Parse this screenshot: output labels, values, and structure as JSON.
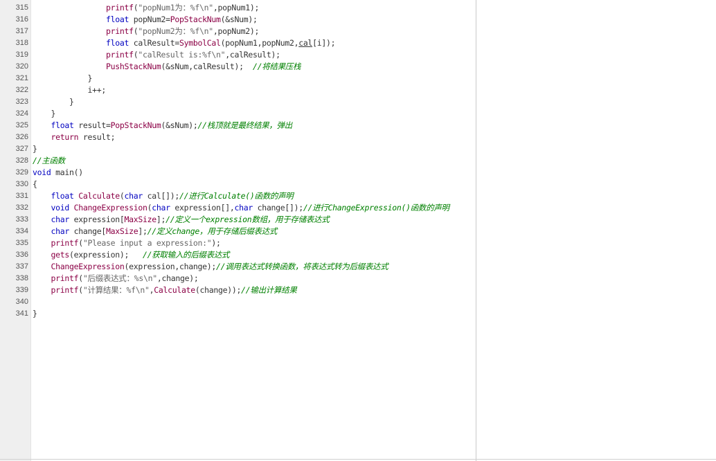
{
  "editor": {
    "lines": [
      {
        "n": "315",
        "segs": [
          {
            "t": "                printf(",
            "c": "fn0"
          },
          {
            "t": "\"popNum1为：%f\\n\"",
            "c": "str"
          },
          {
            "t": ",popNum1);",
            "c": "pl"
          }
        ]
      },
      {
        "n": "316",
        "segs": [
          {
            "t": "                ",
            "c": "pl"
          },
          {
            "t": "float",
            "c": "kw"
          },
          {
            "t": " popNum2=",
            "c": "pl"
          },
          {
            "t": "PopStackNum",
            "c": "fn"
          },
          {
            "t": "(&sNum);",
            "c": "pl"
          }
        ]
      },
      {
        "n": "317",
        "segs": [
          {
            "t": "                ",
            "c": "pl"
          },
          {
            "t": "printf",
            "c": "fn"
          },
          {
            "t": "(",
            "c": "pl"
          },
          {
            "t": "\"popNum2为：%f\\n\"",
            "c": "str"
          },
          {
            "t": ",popNum2);",
            "c": "pl"
          }
        ]
      },
      {
        "n": "318",
        "segs": [
          {
            "t": "                ",
            "c": "pl"
          },
          {
            "t": "float",
            "c": "kw"
          },
          {
            "t": " calResult=",
            "c": "pl"
          },
          {
            "t": "SymbolCal",
            "c": "fn"
          },
          {
            "t": "(popNum1,popNum2,",
            "c": "pl"
          },
          {
            "t": "cal",
            "c": "u"
          },
          {
            "t": "[i]);",
            "c": "pl"
          }
        ]
      },
      {
        "n": "319",
        "segs": [
          {
            "t": "                ",
            "c": "pl"
          },
          {
            "t": "printf",
            "c": "fn"
          },
          {
            "t": "(",
            "c": "pl"
          },
          {
            "t": "\"calResult is:%f\\n\"",
            "c": "str"
          },
          {
            "t": ",calResult);",
            "c": "pl"
          }
        ]
      },
      {
        "n": "320",
        "segs": [
          {
            "t": "                ",
            "c": "pl"
          },
          {
            "t": "PushStackNum",
            "c": "fn"
          },
          {
            "t": "(&sNum,calResult);  ",
            "c": "pl"
          },
          {
            "t": "//将结果压栈",
            "c": "cmt"
          }
        ]
      },
      {
        "n": "321",
        "segs": [
          {
            "t": "            }",
            "c": "pl"
          }
        ]
      },
      {
        "n": "322",
        "segs": [
          {
            "t": "            i++;",
            "c": "pl"
          }
        ]
      },
      {
        "n": "323",
        "segs": [
          {
            "t": "        }",
            "c": "pl"
          }
        ]
      },
      {
        "n": "324",
        "segs": [
          {
            "t": "    }",
            "c": "pl"
          }
        ]
      },
      {
        "n": "325",
        "segs": [
          {
            "t": "    ",
            "c": "pl"
          },
          {
            "t": "float",
            "c": "kw"
          },
          {
            "t": " result=",
            "c": "pl"
          },
          {
            "t": "PopStackNum",
            "c": "fn"
          },
          {
            "t": "(&sNum);",
            "c": "pl"
          },
          {
            "t": "//栈顶就是最终结果，弹出",
            "c": "cmt"
          }
        ]
      },
      {
        "n": "326",
        "segs": [
          {
            "t": "    ",
            "c": "pl"
          },
          {
            "t": "return",
            "c": "fn"
          },
          {
            "t": " result;",
            "c": "pl"
          }
        ]
      },
      {
        "n": "327",
        "segs": [
          {
            "t": "}",
            "c": "pl"
          }
        ]
      },
      {
        "n": "328",
        "segs": [
          {
            "t": "//主函数",
            "c": "cmt"
          }
        ]
      },
      {
        "n": "329",
        "segs": [
          {
            "t": "void",
            "c": "kw"
          },
          {
            "t": " main()",
            "c": "pl"
          }
        ]
      },
      {
        "n": "330",
        "segs": [
          {
            "t": "{",
            "c": "pl"
          }
        ]
      },
      {
        "n": "331",
        "segs": [
          {
            "t": "    ",
            "c": "pl"
          },
          {
            "t": "float",
            "c": "kw"
          },
          {
            "t": " ",
            "c": "pl"
          },
          {
            "t": "Calculate",
            "c": "fn"
          },
          {
            "t": "(",
            "c": "pl"
          },
          {
            "t": "char",
            "c": "kw"
          },
          {
            "t": " cal[]);",
            "c": "pl"
          },
          {
            "t": "//进行Calculate()函数的声明",
            "c": "cmt"
          }
        ]
      },
      {
        "n": "332",
        "segs": [
          {
            "t": "    ",
            "c": "pl"
          },
          {
            "t": "void",
            "c": "kw"
          },
          {
            "t": " ",
            "c": "pl"
          },
          {
            "t": "ChangeExpression",
            "c": "fn"
          },
          {
            "t": "(",
            "c": "pl"
          },
          {
            "t": "char",
            "c": "kw"
          },
          {
            "t": " expression[],",
            "c": "pl"
          },
          {
            "t": "char",
            "c": "kw"
          },
          {
            "t": " change[]);",
            "c": "pl"
          },
          {
            "t": "//进行ChangeExpression()函数的声明",
            "c": "cmt"
          }
        ]
      },
      {
        "n": "333",
        "segs": [
          {
            "t": "    ",
            "c": "pl"
          },
          {
            "t": "char",
            "c": "kw"
          },
          {
            "t": " expression[",
            "c": "pl"
          },
          {
            "t": "MaxSize",
            "c": "mac"
          },
          {
            "t": "];",
            "c": "pl"
          },
          {
            "t": "//定义一个expression数组，用于存储表达式",
            "c": "cmt"
          }
        ]
      },
      {
        "n": "334",
        "segs": [
          {
            "t": "    ",
            "c": "pl"
          },
          {
            "t": "char",
            "c": "kw"
          },
          {
            "t": " change[",
            "c": "pl"
          },
          {
            "t": "MaxSize",
            "c": "mac"
          },
          {
            "t": "];",
            "c": "pl"
          },
          {
            "t": "//定义change，用于存储后缀表达式",
            "c": "cmt"
          }
        ]
      },
      {
        "n": "335",
        "segs": [
          {
            "t": "    ",
            "c": "pl"
          },
          {
            "t": "printf",
            "c": "fn"
          },
          {
            "t": "(",
            "c": "pl"
          },
          {
            "t": "\"Please input a expression:\"",
            "c": "str"
          },
          {
            "t": ");",
            "c": "pl"
          }
        ]
      },
      {
        "n": "336",
        "segs": [
          {
            "t": "    ",
            "c": "pl"
          },
          {
            "t": "gets",
            "c": "fn"
          },
          {
            "t": "(expression);   ",
            "c": "pl"
          },
          {
            "t": "//获取输入的后缀表达式",
            "c": "cmt"
          }
        ]
      },
      {
        "n": "337",
        "segs": [
          {
            "t": "    ",
            "c": "pl"
          },
          {
            "t": "ChangeExpression",
            "c": "fn"
          },
          {
            "t": "(expression,change);",
            "c": "pl"
          },
          {
            "t": "//调用表达式转换函数，将表达式转为后缀表达式",
            "c": "cmt"
          }
        ]
      },
      {
        "n": "338",
        "segs": [
          {
            "t": "    ",
            "c": "pl"
          },
          {
            "t": "printf",
            "c": "fn"
          },
          {
            "t": "(",
            "c": "pl"
          },
          {
            "t": "\"后缀表达式：%s\\n\"",
            "c": "str"
          },
          {
            "t": ",change);",
            "c": "pl"
          }
        ]
      },
      {
        "n": "339",
        "segs": [
          {
            "t": "    ",
            "c": "pl"
          },
          {
            "t": "printf",
            "c": "fn"
          },
          {
            "t": "(",
            "c": "pl"
          },
          {
            "t": "\"计算结果：%f\\n\"",
            "c": "str"
          },
          {
            "t": ",",
            "c": "pl"
          },
          {
            "t": "Calculate",
            "c": "fn"
          },
          {
            "t": "(change));",
            "c": "pl"
          },
          {
            "t": "//输出计算结果",
            "c": "cmt"
          }
        ]
      },
      {
        "n": "340",
        "segs": []
      },
      {
        "n": "341",
        "segs": [
          {
            "t": "}",
            "c": "pl"
          }
        ]
      }
    ]
  }
}
